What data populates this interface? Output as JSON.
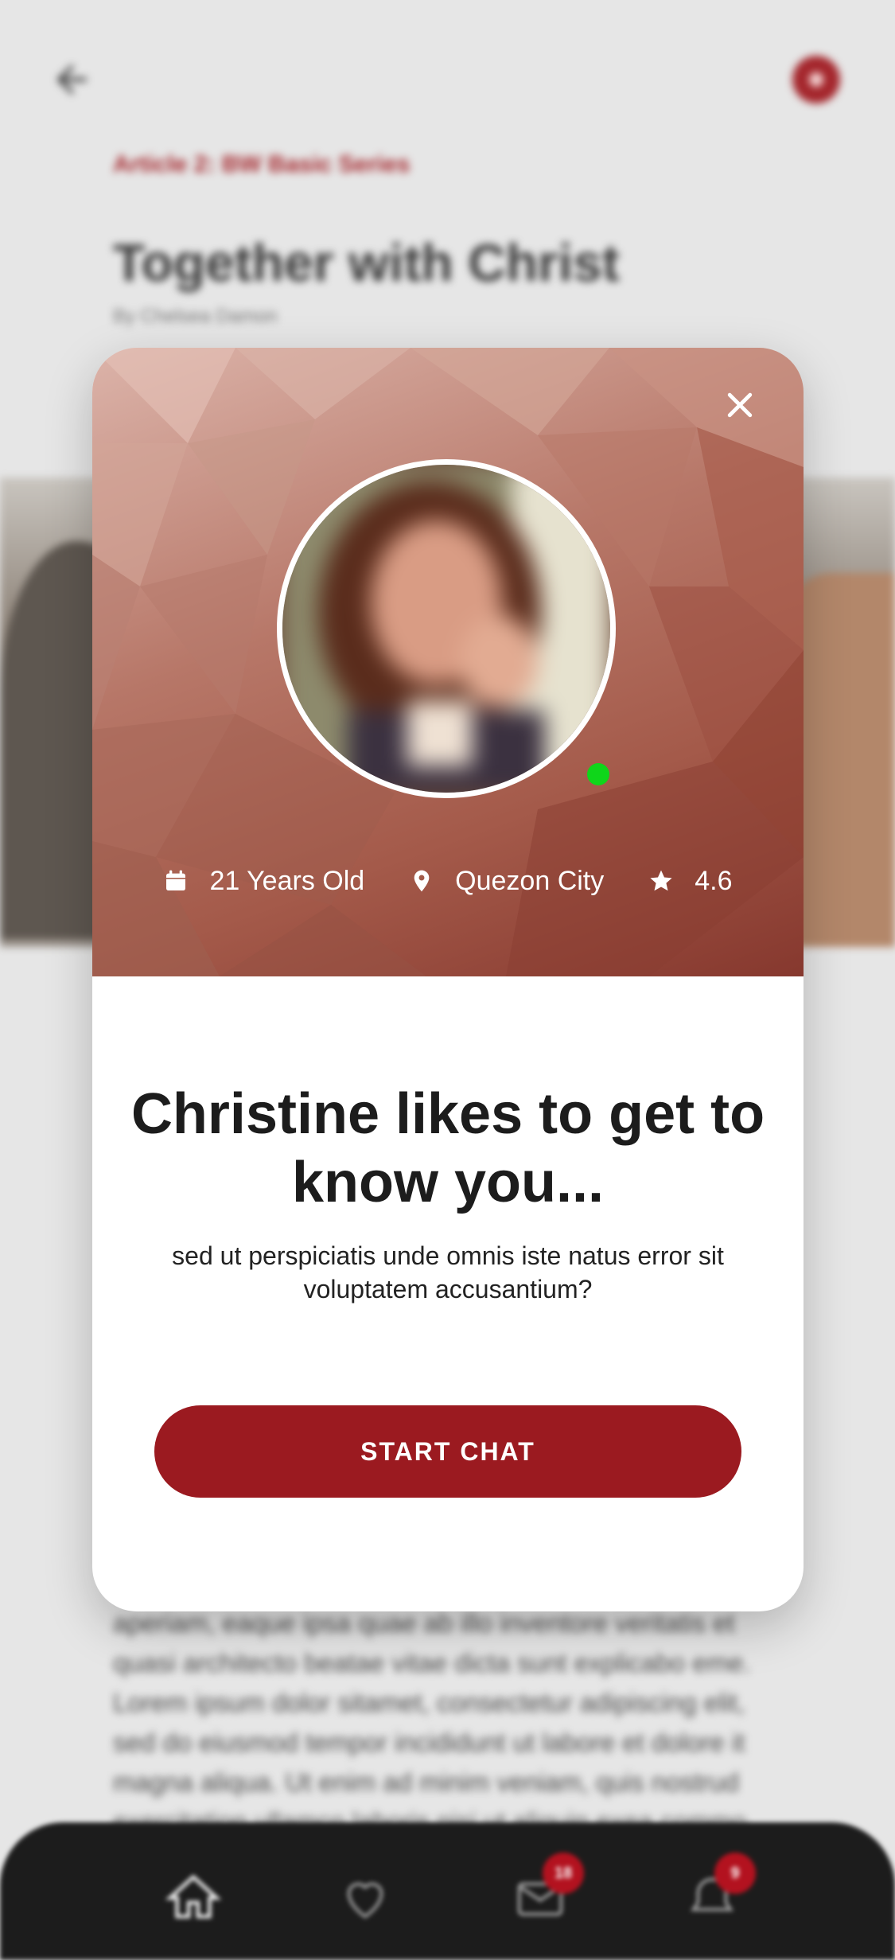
{
  "background_article": {
    "kicker": "Article 2: BW Basic Series",
    "title": "Together with Christ",
    "byline": "By Chelsea Damon",
    "paragraph": "aperiam, eaque ipsa quae ab illo inventore veritatis et quasi architecto beatae vitae dicta sunt explicabo eme. Lorem ipsum dolor sitamet, consectetur adipiscing elit, sed do eiusmod tempor incididunt ut labore et dolore it magna aliqua. Ut enim ad minim veniam, quis nostrud exercitation ullamco laboris nisi ut aliquip exea commo"
  },
  "profile": {
    "age": "21 Years Old",
    "city": "Quezon City",
    "rating": "4.6",
    "online": true
  },
  "modal": {
    "headline": "Christine likes to get to know you...",
    "subtext": "sed ut perspiciatis unde omnis iste natus error sit voluptatem accusantium?",
    "cta_label": "START CHAT"
  },
  "tabbar": {
    "messages_badge": "18",
    "notifications_badge": "9"
  },
  "colors": {
    "brand_red": "#9b1a20",
    "online_green": "#0fd61a"
  },
  "icons": [
    "back-arrow-icon",
    "close-icon",
    "calendar-icon",
    "location-pin-icon",
    "star-icon",
    "home-icon",
    "heart-icon",
    "mail-icon",
    "bell-icon"
  ]
}
